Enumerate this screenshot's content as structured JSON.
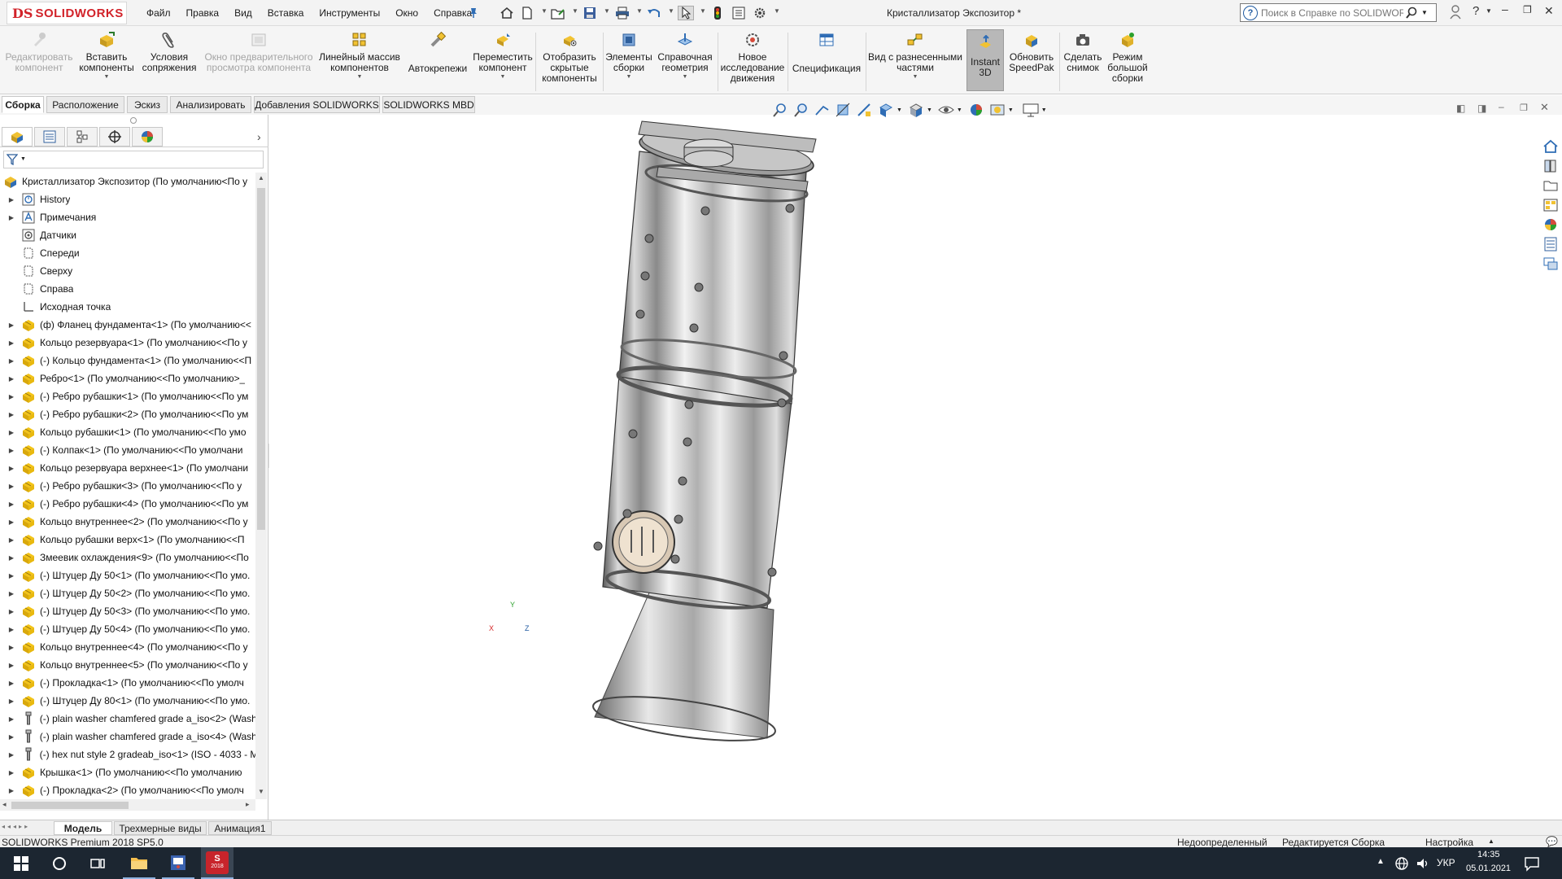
{
  "app": {
    "logo": {
      "ds": "DS",
      "name": "SOLIDWORKS"
    },
    "document_title": "Кристаллизатор Экспозитор *",
    "menu": [
      "Файл",
      "Правка",
      "Вид",
      "Вставка",
      "Инструменты",
      "Окно",
      "Справка"
    ],
    "help_search_placeholder": "Поиск в Справке по SOLIDWORKS"
  },
  "commands": [
    {
      "label": "Редактировать\nкомпонент",
      "enabled": false
    },
    {
      "label": "Вставить\nкомпоненты",
      "enabled": true
    },
    {
      "label": "Условия\nсопряжения",
      "enabled": true
    },
    {
      "label": "Окно предварительного\nпросмотра компонента",
      "enabled": false
    },
    {
      "label": "Линейный массив\nкомпонентов",
      "enabled": true
    },
    {
      "label": "Автокрепежи",
      "enabled": true
    },
    {
      "label": "Переместить\nкомпонент",
      "enabled": true
    },
    {
      "label": "Отобразить\nскрытые\nкомпоненты",
      "enabled": true
    },
    {
      "label": "Элементы\nсборки",
      "enabled": true
    },
    {
      "label": "Справочная\nгеометрия",
      "enabled": true
    },
    {
      "label": "Новое\nисследование\nдвижения",
      "enabled": true
    },
    {
      "label": "Спецификация",
      "enabled": true
    },
    {
      "label": "Вид с разнесенными\nчастями",
      "enabled": true
    },
    {
      "label": "Instant\n3D",
      "enabled": true
    },
    {
      "label": "Обновить\nSpeedPak",
      "enabled": true
    },
    {
      "label": "Сделать\nснимок",
      "enabled": true
    },
    {
      "label": "Режим\nбольшой\nсборки",
      "enabled": true
    }
  ],
  "tabs": [
    "Сборка",
    "Расположение",
    "Эскиз",
    "Анализировать",
    "Добавления SOLIDWORKS",
    "SOLIDWORKS MBD"
  ],
  "active_tab": "Сборка",
  "tree": {
    "root": "Кристаллизатор Экспозитор  (По умолчанию<По у",
    "items": [
      {
        "label": "History",
        "icon": "history-icon"
      },
      {
        "label": "Примечания",
        "icon": "annotations-icon"
      },
      {
        "label": "Датчики",
        "icon": "sensors-icon"
      },
      {
        "label": "Спереди",
        "icon": "plane-icon"
      },
      {
        "label": "Сверху",
        "icon": "plane-icon"
      },
      {
        "label": "Справа",
        "icon": "plane-icon"
      },
      {
        "label": "Исходная точка",
        "icon": "origin-icon"
      },
      {
        "label": "(ф) Фланец фундамента<1> (По умолчанию<<",
        "icon": "part-icon"
      },
      {
        "label": "Кольцо резервуара<1> (По умолчанию<<По у",
        "icon": "part-icon"
      },
      {
        "label": "(-) Кольцо фундамента<1> (По умолчанию<<П",
        "icon": "part-icon"
      },
      {
        "label": "Ребро<1> (По умолчанию<<По умолчанию>_",
        "icon": "part-icon"
      },
      {
        "label": "(-) Ребро рубашки<1> (По умолчанию<<По ум",
        "icon": "part-icon"
      },
      {
        "label": "(-) Ребро рубашки<2> (По умолчанию<<По ум",
        "icon": "part-icon"
      },
      {
        "label": "Кольцо рубашки<1> (По умолчанию<<По умо",
        "icon": "part-icon"
      },
      {
        "label": "(-) Колпак<1> (По умолчанию<<По умолчани",
        "icon": "part-icon"
      },
      {
        "label": "Кольцо резервуара верхнее<1> (По умолчани",
        "icon": "part-icon"
      },
      {
        "label": "(-) Ребро рубашки<3> (По умолчанию<<По у",
        "icon": "part-icon"
      },
      {
        "label": "(-) Ребро рубашки<4> (По умолчанию<<По ум",
        "icon": "part-icon"
      },
      {
        "label": "Кольцо внутреннее<2> (По умолчанию<<По у",
        "icon": "part-icon"
      },
      {
        "label": "Кольцо рубашки верх<1> (По умолчанию<<П",
        "icon": "part-icon"
      },
      {
        "label": "Змеевик охлаждения<9> (По умолчанию<<По",
        "icon": "part-icon"
      },
      {
        "label": "(-) Штуцер Ду 50<1> (По умолчанию<<По умо.",
        "icon": "part-icon"
      },
      {
        "label": "(-) Штуцер Ду 50<2> (По умолчанию<<По умо.",
        "icon": "part-icon"
      },
      {
        "label": "(-) Штуцер Ду 50<3> (По умолчанию<<По умо.",
        "icon": "part-icon"
      },
      {
        "label": "(-) Штуцер Ду 50<4> (По умолчанию<<По умо.",
        "icon": "part-icon"
      },
      {
        "label": "Кольцо внутреннее<4> (По умолчанию<<По у",
        "icon": "part-icon"
      },
      {
        "label": "Кольцо внутреннее<5> (По умолчанию<<По у",
        "icon": "part-icon"
      },
      {
        "label": "(-) Прокладка<1> (По умолчанию<<По умолч",
        "icon": "part-icon"
      },
      {
        "label": "(-) Штуцер Ду 80<1> (По умолчанию<<По умо.",
        "icon": "part-icon"
      },
      {
        "label": "(-) plain washer chamfered grade a_iso<2> (Wash",
        "icon": "toolbox-icon"
      },
      {
        "label": "(-) plain washer chamfered grade a_iso<4> (Wash",
        "icon": "toolbox-icon"
      },
      {
        "label": "(-) hex nut style 2 gradeab_iso<1> (ISO - 4033 - M",
        "icon": "toolbox-icon"
      },
      {
        "label": "Крышка<1> (По умолчанию<<По умолчанию",
        "icon": "part-icon"
      },
      {
        "label": "(-) Прокладка<2> (По умолчанию<<По умолч",
        "icon": "part-icon"
      }
    ]
  },
  "bottom_tabs": [
    "Модель",
    "Трехмерные виды",
    "Анимация1"
  ],
  "active_bottom_tab": "Модель",
  "status": {
    "version": "SOLIDWORKS Premium 2018 SP5.0",
    "definition": "Недоопределенный",
    "mode": "Редактируется Сборка",
    "settings": "Настройка"
  },
  "taskbar": {
    "lang": "УКР",
    "time": "14:35",
    "date": "05.01.2021",
    "sw_badge": "2018"
  },
  "axes": {
    "x": "X",
    "y": "Y",
    "z": "Z"
  },
  "colors": {
    "brand_red": "#d2232a",
    "accent_blue": "#1f5aa0",
    "taskbar": "#1c2631",
    "part_yellow": "#e8b400"
  }
}
